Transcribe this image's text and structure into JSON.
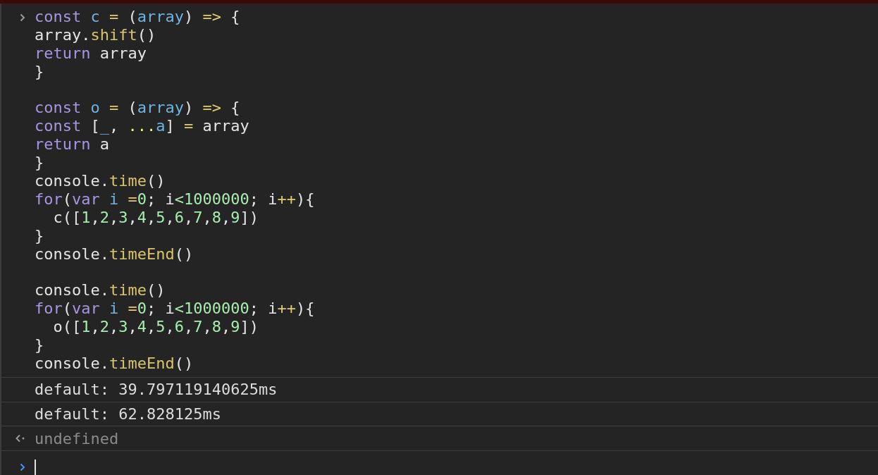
{
  "input": {
    "lines": [
      {
        "kind": "code",
        "tokens": [
          {
            "text": "const",
            "kind": "keyword"
          },
          {
            "text": " c",
            "kind": "def"
          },
          {
            "text": " =",
            "kind": "op"
          },
          {
            "text": " (",
            "kind": "plain"
          },
          {
            "text": "array",
            "kind": "def"
          },
          {
            "text": ") ",
            "kind": "plain"
          },
          {
            "text": "=>",
            "kind": "op"
          },
          {
            "text": " {",
            "kind": "plain"
          }
        ]
      },
      {
        "kind": "code",
        "tokens": [
          {
            "text": "array.",
            "kind": "plain"
          },
          {
            "text": "shift",
            "kind": "fn"
          },
          {
            "text": "()",
            "kind": "plain"
          }
        ]
      },
      {
        "kind": "code",
        "tokens": [
          {
            "text": "return",
            "kind": "keyword"
          },
          {
            "text": " array",
            "kind": "plain"
          }
        ]
      },
      {
        "kind": "code",
        "tokens": [
          {
            "text": "}",
            "kind": "plain"
          }
        ]
      },
      {
        "kind": "blank"
      },
      {
        "kind": "code",
        "tokens": [
          {
            "text": "const",
            "kind": "keyword"
          },
          {
            "text": " o",
            "kind": "def"
          },
          {
            "text": " =",
            "kind": "op"
          },
          {
            "text": " (",
            "kind": "plain"
          },
          {
            "text": "array",
            "kind": "def"
          },
          {
            "text": ") ",
            "kind": "plain"
          },
          {
            "text": "=>",
            "kind": "op"
          },
          {
            "text": " {",
            "kind": "plain"
          }
        ]
      },
      {
        "kind": "code",
        "tokens": [
          {
            "text": "const",
            "kind": "keyword"
          },
          {
            "text": " [",
            "kind": "plain"
          },
          {
            "text": "_",
            "kind": "def"
          },
          {
            "text": ", ",
            "kind": "plain"
          },
          {
            "text": "...",
            "kind": "spread"
          },
          {
            "text": "a",
            "kind": "def"
          },
          {
            "text": "] ",
            "kind": "plain"
          },
          {
            "text": "=",
            "kind": "op"
          },
          {
            "text": " array",
            "kind": "plain"
          }
        ]
      },
      {
        "kind": "code",
        "tokens": [
          {
            "text": "return",
            "kind": "keyword"
          },
          {
            "text": " a",
            "kind": "plain"
          }
        ]
      },
      {
        "kind": "code",
        "tokens": [
          {
            "text": "}",
            "kind": "plain"
          }
        ]
      },
      {
        "kind": "code",
        "tokens": [
          {
            "text": "console.",
            "kind": "plain"
          },
          {
            "text": "time",
            "kind": "fn"
          },
          {
            "text": "()",
            "kind": "plain"
          }
        ]
      },
      {
        "kind": "code",
        "tokens": [
          {
            "text": "for",
            "kind": "keyword"
          },
          {
            "text": "(",
            "kind": "plain"
          },
          {
            "text": "var",
            "kind": "keyword"
          },
          {
            "text": " i",
            "kind": "def"
          },
          {
            "text": " =",
            "kind": "op"
          },
          {
            "text": "0",
            "kind": "num"
          },
          {
            "text": "; i",
            "kind": "plain"
          },
          {
            "text": "<",
            "kind": "num"
          },
          {
            "text": "1000000",
            "kind": "num"
          },
          {
            "text": "; i",
            "kind": "plain"
          },
          {
            "text": "++",
            "kind": "op"
          },
          {
            "text": "){",
            "kind": "plain"
          }
        ]
      },
      {
        "kind": "code",
        "tokens": [
          {
            "text": "  c([",
            "kind": "plain"
          },
          {
            "text": "1",
            "kind": "num"
          },
          {
            "text": ",",
            "kind": "plain"
          },
          {
            "text": "2",
            "kind": "num"
          },
          {
            "text": ",",
            "kind": "plain"
          },
          {
            "text": "3",
            "kind": "num"
          },
          {
            "text": ",",
            "kind": "plain"
          },
          {
            "text": "4",
            "kind": "num"
          },
          {
            "text": ",",
            "kind": "plain"
          },
          {
            "text": "5",
            "kind": "num"
          },
          {
            "text": ",",
            "kind": "plain"
          },
          {
            "text": "6",
            "kind": "num"
          },
          {
            "text": ",",
            "kind": "plain"
          },
          {
            "text": "7",
            "kind": "num"
          },
          {
            "text": ",",
            "kind": "plain"
          },
          {
            "text": "8",
            "kind": "num"
          },
          {
            "text": ",",
            "kind": "plain"
          },
          {
            "text": "9",
            "kind": "num"
          },
          {
            "text": "])",
            "kind": "plain"
          }
        ]
      },
      {
        "kind": "code",
        "tokens": [
          {
            "text": "}",
            "kind": "plain"
          }
        ]
      },
      {
        "kind": "code",
        "tokens": [
          {
            "text": "console.",
            "kind": "plain"
          },
          {
            "text": "timeEnd",
            "kind": "fn"
          },
          {
            "text": "()",
            "kind": "plain"
          }
        ]
      },
      {
        "kind": "blank"
      },
      {
        "kind": "code",
        "tokens": [
          {
            "text": "console.",
            "kind": "plain"
          },
          {
            "text": "time",
            "kind": "fn"
          },
          {
            "text": "()",
            "kind": "plain"
          }
        ]
      },
      {
        "kind": "code",
        "tokens": [
          {
            "text": "for",
            "kind": "keyword"
          },
          {
            "text": "(",
            "kind": "plain"
          },
          {
            "text": "var",
            "kind": "keyword"
          },
          {
            "text": " i",
            "kind": "def"
          },
          {
            "text": " =",
            "kind": "op"
          },
          {
            "text": "0",
            "kind": "num"
          },
          {
            "text": "; i",
            "kind": "plain"
          },
          {
            "text": "<",
            "kind": "num"
          },
          {
            "text": "1000000",
            "kind": "num"
          },
          {
            "text": "; i",
            "kind": "plain"
          },
          {
            "text": "++",
            "kind": "op"
          },
          {
            "text": "){",
            "kind": "plain"
          }
        ]
      },
      {
        "kind": "code",
        "tokens": [
          {
            "text": "  o([",
            "kind": "plain"
          },
          {
            "text": "1",
            "kind": "num"
          },
          {
            "text": ",",
            "kind": "plain"
          },
          {
            "text": "2",
            "kind": "num"
          },
          {
            "text": ",",
            "kind": "plain"
          },
          {
            "text": "3",
            "kind": "num"
          },
          {
            "text": ",",
            "kind": "plain"
          },
          {
            "text": "4",
            "kind": "num"
          },
          {
            "text": ",",
            "kind": "plain"
          },
          {
            "text": "5",
            "kind": "num"
          },
          {
            "text": ",",
            "kind": "plain"
          },
          {
            "text": "6",
            "kind": "num"
          },
          {
            "text": ",",
            "kind": "plain"
          },
          {
            "text": "7",
            "kind": "num"
          },
          {
            "text": ",",
            "kind": "plain"
          },
          {
            "text": "8",
            "kind": "num"
          },
          {
            "text": ",",
            "kind": "plain"
          },
          {
            "text": "9",
            "kind": "num"
          },
          {
            "text": "])",
            "kind": "plain"
          }
        ]
      },
      {
        "kind": "code",
        "tokens": [
          {
            "text": "}",
            "kind": "plain"
          }
        ]
      },
      {
        "kind": "code",
        "tokens": [
          {
            "text": "console.",
            "kind": "plain"
          },
          {
            "text": "timeEnd",
            "kind": "fn"
          },
          {
            "text": "()",
            "kind": "plain"
          }
        ]
      }
    ]
  },
  "messages": [
    {
      "kind": "log",
      "text": "default: 39.797119140625ms"
    },
    {
      "kind": "log",
      "text": "default: 62.828125ms"
    },
    {
      "kind": "result",
      "text": "undefined"
    }
  ]
}
